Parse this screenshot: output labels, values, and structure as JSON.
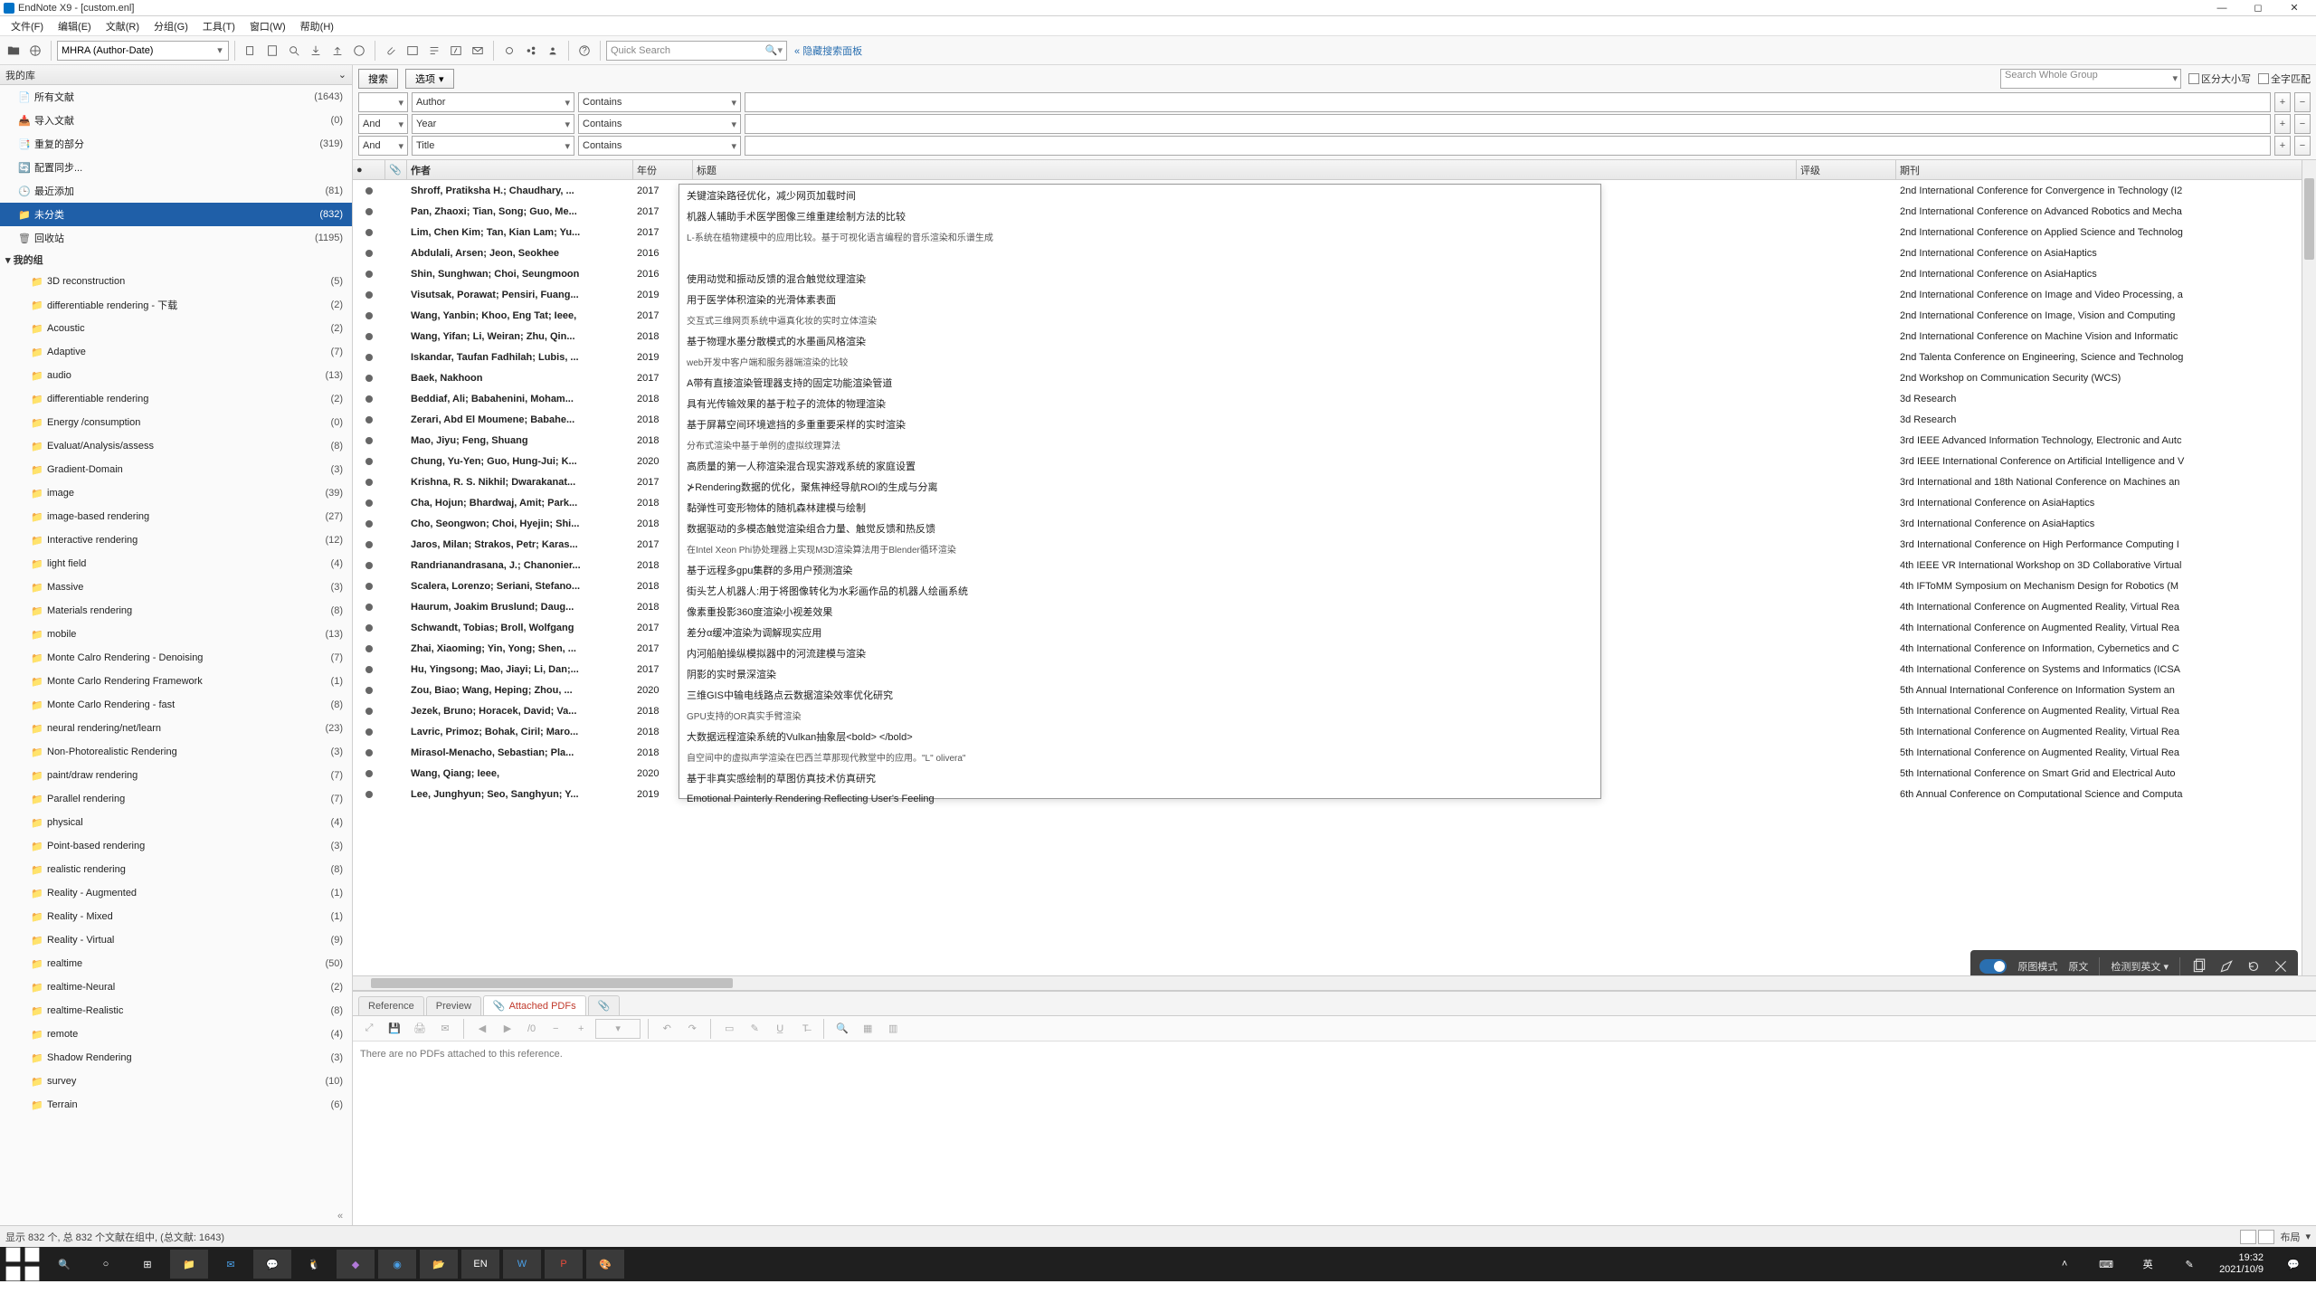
{
  "window": {
    "title": "EndNote X9 - [custom.enl]",
    "min": "—",
    "max": "◻",
    "close": "✕"
  },
  "menu": [
    "文件(F)",
    "编辑(E)",
    "文献(R)",
    "分组(G)",
    "工具(T)",
    "窗口(W)",
    "帮助(H)"
  ],
  "toolbar": {
    "style": "MHRA (Author-Date)",
    "quick_search": "Quick Search",
    "hide_search": "隐藏搜索面板"
  },
  "sidebar": {
    "header": "我的库",
    "expand_icon": "⌄",
    "items": [
      {
        "icon": "📄",
        "label": "所有文献",
        "count": "(1643)",
        "lvl": 1
      },
      {
        "icon": "📥",
        "label": "导入文献",
        "count": "(0)",
        "lvl": 1
      },
      {
        "icon": "📑",
        "label": "重复的部分",
        "count": "(319)",
        "lvl": 1
      },
      {
        "icon": "🔄",
        "label": "配置同步...",
        "count": "",
        "lvl": 1
      },
      {
        "icon": "🕒",
        "label": "最近添加",
        "count": "(81)",
        "lvl": 1
      },
      {
        "icon": "📁",
        "label": "未分类",
        "count": "(832)",
        "lvl": 1,
        "sel": true
      },
      {
        "icon": "🗑",
        "label": "回收站",
        "count": "(1195)",
        "lvl": 1
      }
    ],
    "groups_header": "我的组",
    "groups": [
      {
        "label": "3D reconstruction",
        "count": "(5)"
      },
      {
        "label": "differentiable rendering - 下载",
        "count": "(2)"
      },
      {
        "label": "Acoustic",
        "count": "(2)"
      },
      {
        "label": "Adaptive",
        "count": "(7)"
      },
      {
        "label": "audio",
        "count": "(13)"
      },
      {
        "label": "differentiable rendering",
        "count": "(2)"
      },
      {
        "label": "Energy /consumption",
        "count": "(0)"
      },
      {
        "label": "Evaluat/Analysis/assess",
        "count": "(8)"
      },
      {
        "label": "Gradient-Domain",
        "count": "(3)"
      },
      {
        "label": "image",
        "count": "(39)"
      },
      {
        "label": "image-based rendering",
        "count": "(27)"
      },
      {
        "label": "Interactive  rendering",
        "count": "(12)"
      },
      {
        "label": "light field",
        "count": "(4)"
      },
      {
        "label": "Massive",
        "count": "(3)"
      },
      {
        "label": "Materials rendering",
        "count": "(8)"
      },
      {
        "label": "mobile",
        "count": "(13)"
      },
      {
        "label": "Monte Calro Rendering - Denoising",
        "count": "(7)"
      },
      {
        "label": "Monte Carlo  Rendering Framework",
        "count": "(1)"
      },
      {
        "label": "Monte Carlo Rendering - fast",
        "count": "(8)"
      },
      {
        "label": "neural rendering/net/learn",
        "count": "(23)"
      },
      {
        "label": "Non-Photorealistic Rendering",
        "count": "(3)"
      },
      {
        "label": "paint/draw rendering",
        "count": "(7)"
      },
      {
        "label": "Parallel rendering",
        "count": "(7)"
      },
      {
        "label": "physical",
        "count": "(4)"
      },
      {
        "label": "Point-based rendering",
        "count": "(3)"
      },
      {
        "label": "realistic rendering",
        "count": "(8)"
      },
      {
        "label": "Reality - Augmented",
        "count": "(1)"
      },
      {
        "label": "Reality - Mixed",
        "count": "(1)"
      },
      {
        "label": "Reality - Virtual",
        "count": "(9)"
      },
      {
        "label": "realtime",
        "count": "(50)"
      },
      {
        "label": "realtime-Neural",
        "count": "(2)"
      },
      {
        "label": "realtime-Realistic",
        "count": "(8)"
      },
      {
        "label": "remote",
        "count": "(4)"
      },
      {
        "label": "Shadow Rendering",
        "count": "(3)"
      },
      {
        "label": "survey",
        "count": "(10)"
      },
      {
        "label": "Terrain",
        "count": "(6)"
      }
    ]
  },
  "search": {
    "btn_search": "搜索",
    "btn_options": "选项",
    "options_arrow": "▾",
    "whole_group": "Search Whole Group",
    "chk_case": "区分大小写",
    "chk_whole": "全字匹配",
    "rows": [
      {
        "bool": "",
        "field": "Author",
        "op": "Contains"
      },
      {
        "bool": "And",
        "field": "Year",
        "op": "Contains"
      },
      {
        "bool": "And",
        "field": "Title",
        "op": "Contains"
      }
    ],
    "plus": "+",
    "minus": "−"
  },
  "columns": {
    "read": "●",
    "attach": "📎",
    "author": "作者",
    "year": "年份",
    "title": "标题",
    "rating": "评级",
    "journal": "期刊"
  },
  "refs": [
    {
      "a": "Shroff, Pratiksha H.; Chaudhary, ...",
      "y": "2017",
      "j": "2nd International Conference for Convergence in Technology (I2"
    },
    {
      "a": "Pan, Zhaoxi; Tian, Song; Guo, Me...",
      "y": "2017",
      "j": "2nd International Conference on Advanced Robotics and Mecha"
    },
    {
      "a": "Lim, Chen Kim; Tan, Kian Lam; Yu...",
      "y": "2017",
      "j": "2nd International Conference on Applied Science and Technolog"
    },
    {
      "a": "Abdulali, Arsen; Jeon, Seokhee",
      "y": "2016",
      "j": "2nd International Conference on AsiaHaptics"
    },
    {
      "a": "Shin, Sunghwan; Choi, Seungmoon",
      "y": "2016",
      "j": "2nd International Conference on AsiaHaptics"
    },
    {
      "a": "Visutsak, Porawat; Pensiri, Fuang...",
      "y": "2019",
      "j": "2nd International Conference on Image and Video Processing, a"
    },
    {
      "a": "Wang, Yanbin; Khoo, Eng Tat; Ieee, ",
      "y": "2017",
      "j": "2nd International Conference on Image, Vision and Computing"
    },
    {
      "a": "Wang, Yifan; Li, Weiran; Zhu, Qin...",
      "y": "2018",
      "j": "2nd International Conference on Machine Vision and Informatic"
    },
    {
      "a": "Iskandar, Taufan Fadhilah; Lubis, ...",
      "y": "2019",
      "j": "2nd Talenta Conference on Engineering, Science and Technolog"
    },
    {
      "a": "Baek, Nakhoon",
      "y": "2017",
      "j": "2nd Workshop on Communication Security (WCS)"
    },
    {
      "a": "Beddiaf, Ali; Babahenini, Moham...",
      "y": "2018",
      "j": "3d Research"
    },
    {
      "a": "Zerari, Abd El Moumene; Babahe...",
      "y": "2018",
      "j": "3d Research"
    },
    {
      "a": "Mao, Jiyu; Feng, Shuang",
      "y": "2018",
      "j": "3rd IEEE Advanced Information Technology, Electronic and Autc"
    },
    {
      "a": "Chung, Yu-Yen; Guo, Hung-Jui; K...",
      "y": "2020",
      "j": "3rd IEEE International Conference on Artificial Intelligence and V"
    },
    {
      "a": "Krishna, R. S. Nikhil; Dwarakanat...",
      "y": "2017",
      "j": "3rd International and 18th National Conference on Machines an"
    },
    {
      "a": "Cha, Hojun; Bhardwaj, Amit; Park...",
      "y": "2018",
      "j": "3rd International Conference on AsiaHaptics"
    },
    {
      "a": "Cho, Seongwon; Choi, Hyejin; Shi...",
      "y": "2018",
      "j": "3rd International Conference on AsiaHaptics"
    },
    {
      "a": "Jaros, Milan; Strakos, Petr; Karas...",
      "y": "2017",
      "j": "3rd International Conference on High Performance Computing I"
    },
    {
      "a": "Randrianandrasana, J.; Chanonier...",
      "y": "2018",
      "j": "4th IEEE VR International Workshop on 3D Collaborative Virtual"
    },
    {
      "a": "Scalera, Lorenzo; Seriani, Stefano...",
      "y": "2018",
      "j": "4th IFToMM Symposium on Mechanism Design for Robotics (M"
    },
    {
      "a": "Haurum, Joakim Bruslund; Daug...",
      "y": "2018",
      "j": "4th International Conference on Augmented Reality, Virtual Rea"
    },
    {
      "a": "Schwandt, Tobias; Broll, Wolfgang",
      "y": "2017",
      "j": "4th International Conference on Augmented Reality, Virtual Rea"
    },
    {
      "a": "Zhai, Xiaoming; Yin, Yong; Shen, ...",
      "y": "2017",
      "j": "4th International Conference on Information, Cybernetics and C"
    },
    {
      "a": "Hu, Yingsong; Mao, Jiayi; Li, Dan;...",
      "y": "2017",
      "j": "4th International Conference on Systems and Informatics (ICSA"
    },
    {
      "a": "Zou, Biao; Wang, Heping; Zhou, ...",
      "y": "2020",
      "j": "5th Annual International Conference on Information System an"
    },
    {
      "a": "Jezek, Bruno; Horacek, David; Va...",
      "y": "2018",
      "j": "5th International Conference on Augmented Reality, Virtual Rea"
    },
    {
      "a": "Lavric, Primoz; Bohak, Ciril; Maro...",
      "y": "2018",
      "j": "5th International Conference on Augmented Reality, Virtual Rea"
    },
    {
      "a": "Mirasol-Menacho, Sebastian; Pla...",
      "y": "2018",
      "j": "5th International Conference on Augmented Reality, Virtual Rea"
    },
    {
      "a": "Wang, Qiang; Ieee, ",
      "y": "2020",
      "j": "5th International Conference on Smart Grid and Electrical Auto"
    },
    {
      "a": "Lee, Junghyun; Seo, Sanghyun; Y...",
      "y": "2019",
      "j": "6th Annual Conference on Computational Science and Computa"
    }
  ],
  "overlay_rows": [
    {
      "t": "关键渲染路径优化，减少网页加载时间",
      "s": 0
    },
    {
      "t": "机器人辅助手术医学图像三维重建绘制方法的比较",
      "s": 0
    },
    {
      "t": "L-系统在植物建模中的应用比较。基于可视化语言编程的音乐渲染和乐谱生成",
      "s": 1
    },
    {
      "t": "",
      "s": 0
    },
    {
      "t": "使用动觉和振动反馈的混合触觉纹理渲染",
      "s": 0
    },
    {
      "t": "用于医学体积渲染的光滑体素表面",
      "s": 0
    },
    {
      "t": "交互式三维网页系统中逼真化妆的实时立体渲染",
      "s": 1
    },
    {
      "t": "基于物理水墨分散模式的水墨画风格渲染",
      "s": 0
    },
    {
      "t": "web开发中客户端和服务器端渲染的比较",
      "s": 1
    },
    {
      "t": "A带有直接渲染管理器支持的固定功能渲染管道",
      "s": 0
    },
    {
      "t": "具有光传输效果的基于粒子的流体的物理渲染",
      "s": 0
    },
    {
      "t": "基于屏幕空间环境遮挡的多重重要采样的实时渲染",
      "s": 0
    },
    {
      "t": "分布式渲染中基于单例的虚拟纹理算法",
      "s": 1
    },
    {
      "t": "高质量的第一人称渲染混合现实游戏系统的家庭设置",
      "s": 0
    },
    {
      "t": "⊁Rendering数据的优化，聚焦神经导航ROI的生成与分离",
      "s": 0
    },
    {
      "t": "黏弹性可变形物体的随机森林建模与绘制",
      "s": 0
    },
    {
      "t": "数据驱动的多模态触觉渲染组合力量、触觉反馈和热反馈",
      "s": 0
    },
    {
      "t": "在Intel Xeon Phi协处理器上实现M3D渲染算法用于Blender循环渲染",
      "s": 1
    },
    {
      "t": "基于远程多gpu集群的多用户预测渲染",
      "s": 0
    },
    {
      "t": "街头艺人机器人:用于将图像转化为水彩画作品的机器人绘画系统",
      "s": 0
    },
    {
      "t": "像素重投影360度渲染小视差效果",
      "s": 0
    },
    {
      "t": "差分α缓冲渲染为调解现实应用",
      "s": 0
    },
    {
      "t": "内河船舶操纵模拟器中的河流建模与渲染",
      "s": 0
    },
    {
      "t": "阴影的实时景深渲染",
      "s": 0
    },
    {
      "t": "三维GIS中输电线路点云数据渲染效率优化研究",
      "s": 0
    },
    {
      "t": "GPU支持的OR真实手臂渲染",
      "s": 1
    },
    {
      "t": "大数据远程渲染系统的Vulkan抽象层<bold> </bold>",
      "s": 0
    },
    {
      "t": "自空间中的虚拟声学渲染在巴西兰草那现代教堂中的应用。\"L\" olivera\"",
      "s": 1
    },
    {
      "t": "基于非真实感绘制的草图仿真技术仿真研究",
      "s": 0
    },
    {
      "t": "Emotional Painterly Rendering Reflecting User's Feeling",
      "s": 0
    }
  ],
  "transbar": {
    "mode": "原图模式",
    "original": "原文",
    "detect": "检测到英文"
  },
  "tabs": {
    "reference": "Reference",
    "preview": "Preview",
    "attached": "Attached PDFs",
    "clip": "📎"
  },
  "pdf": {
    "empty": "There are no PDFs attached to this reference.",
    "pageof": "/0"
  },
  "status": {
    "left": "显示 832 个, 总 832 个文献在组中, (总文献: 1643)",
    "layout": "布局"
  },
  "taskbar": {
    "time": "19:32",
    "date": "2021/10/9"
  }
}
